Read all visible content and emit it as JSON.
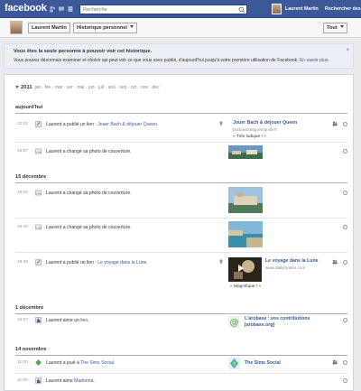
{
  "topbar": {
    "logo": "facebook",
    "search_placeholder": "Recherche",
    "user_name": "Laurent Martin",
    "friends_link": "Rechercher des"
  },
  "header": {
    "name_button": "Laurent Martin",
    "history_button": "Historique personnel",
    "filter_button": "Tout"
  },
  "notice": {
    "title": "Vous êtes la seule personne à pouvoir voir cet historique.",
    "text": "Vous pouvez désormais examiner et choisir qui peut voir ce que vous avez publié, d'aujourd'hui jusqu'à votre première utilisation de Facebook.",
    "link": "En savoir plus."
  },
  "timeline": {
    "year": "2011",
    "months": [
      "jan",
      "fév",
      "mar",
      "avr",
      "mai",
      "jun",
      "juil",
      "aoû",
      "sep",
      "oct",
      "nov",
      "déc"
    ],
    "sections": {
      "today": "aujourd'hui",
      "dec15": "15 décembre",
      "dec1": "1 décembre",
      "nov14": "14 novembre"
    },
    "rows": [
      {
        "time": "22:02",
        "text": "Laurent a publié un lien : ",
        "link": "Jouer Bach & déjouer Queen.",
        "ptitle": "Jouer Bach & déjouer Queen",
        "psub": "podcast.blog.lemonde.fr",
        "pquote": "« Très ludique ! »"
      },
      {
        "time": "16:57",
        "text": "Laurent a changé sa photo de couverture."
      },
      {
        "time": "18:20",
        "text": "Laurent a changé sa photo de couverture."
      },
      {
        "time": "18:20",
        "text": "Laurent a changé sa photo de couverture."
      },
      {
        "time": "18:38",
        "text": "Laurent a publié un lien : ",
        "link": "Le voyage dans la Lune.",
        "ptitle": "Le voyage dans la Lune",
        "psub": "www.dailymotion.com",
        "pquote": "« Magnifique ! »"
      },
      {
        "time": "10:57",
        "text": "Laurent aime un ",
        "link": "lien",
        "after": ".",
        "ptitle": "L'arobase : vos contributions [arobase.org]"
      },
      {
        "time": "11:00",
        "text": "Laurent a joué à ",
        "link": "The Sims Social",
        "after": ".",
        "ptitle": "The Sims Social"
      },
      {
        "time": "11:00",
        "text": "Laurent aime ",
        "link": "Madonna",
        "after": "."
      }
    ]
  },
  "colors": {
    "brand_blue": "#3b5998",
    "link_blue": "#3b5998",
    "notice_bg": "#eceff5"
  }
}
